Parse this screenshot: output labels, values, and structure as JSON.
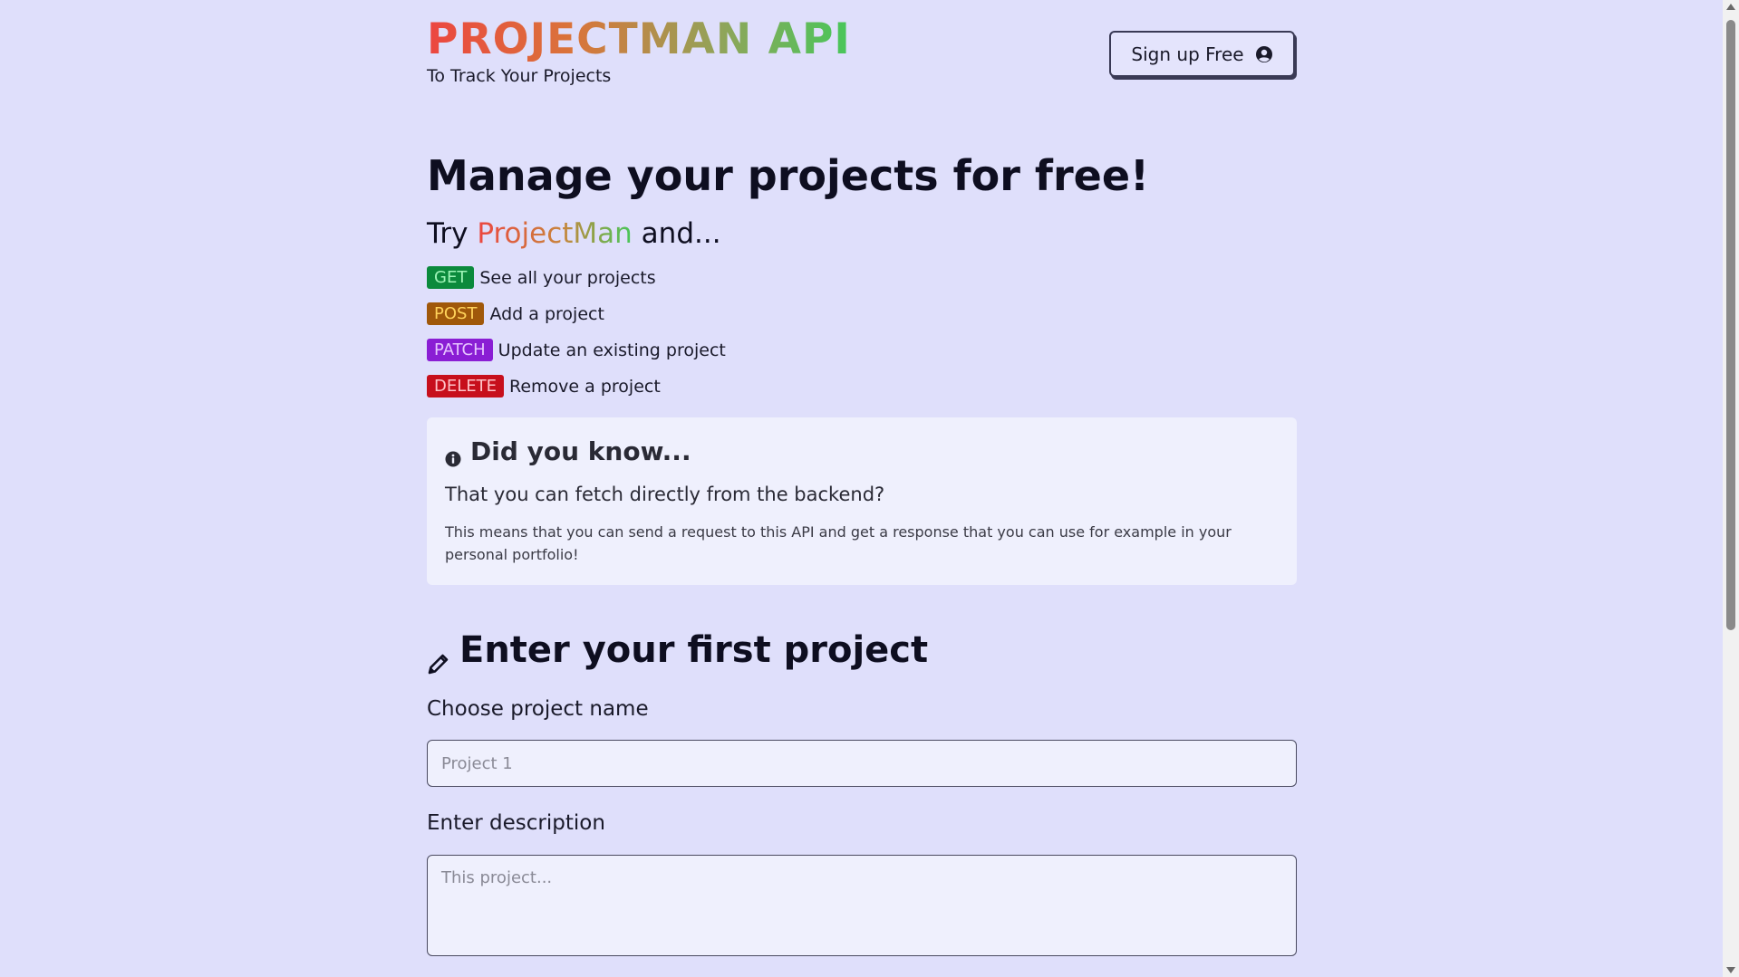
{
  "header": {
    "brand": "PROJECTMAN API",
    "tagline": "To Track Your Projects",
    "signup_label": "Sign up Free",
    "signup_icon": "user-circle-icon"
  },
  "hero": {
    "title": "Manage your projects for free!",
    "try_prefix": "Try",
    "try_brand": "ProjectMan",
    "try_suffix": "and...",
    "methods": [
      {
        "method": "GET",
        "description": "See all your projects",
        "badge_bg": "#0b8a3c",
        "badge_fg": "#9ff5b8"
      },
      {
        "method": "POST",
        "description": "Add a project",
        "badge_bg": "#a0580a",
        "badge_fg": "#ffd25a"
      },
      {
        "method": "PATCH",
        "description": "Update an existing project",
        "badge_bg": "#8a1ed4",
        "badge_fg": "#e7c6ff"
      },
      {
        "method": "DELETE",
        "description": "Remove a project",
        "badge_bg": "#c70f1c",
        "badge_fg": "#ffc3c8"
      }
    ]
  },
  "info": {
    "icon": "info-circle-icon",
    "title": "Did you know...",
    "question": "That you can fetch directly from the backend?",
    "body": "This means that you can send a request to this API and get a response that you can use for example in your personal portfolio!"
  },
  "form": {
    "icon": "pencil-icon",
    "title": "Enter your first project",
    "name_label": "Choose project name",
    "name_placeholder": "Project 1",
    "name_value": "",
    "description_label": "Enter description",
    "description_placeholder": "This project...",
    "description_value": ""
  },
  "colors": {
    "background": "#dfdffb",
    "card": "#eff0fd",
    "brand_gradient_start": "#ec4640",
    "brand_gradient_end": "#47c75a"
  }
}
